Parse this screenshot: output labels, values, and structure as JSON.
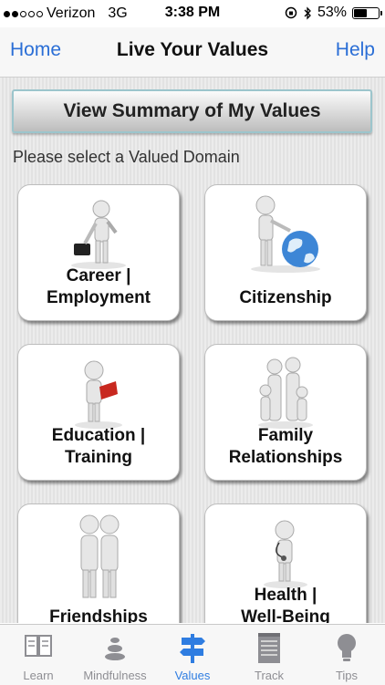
{
  "status": {
    "carrier": "Verizon",
    "network": "3G",
    "time": "3:38 PM",
    "battery_text": "53%",
    "battery_level": 0.53
  },
  "nav": {
    "left": "Home",
    "title": "Live Your Values",
    "right": "Help"
  },
  "summary_button": "View Summary of My Values",
  "prompt": "Please select a Valued Domain",
  "domains": [
    {
      "line1": "Career |",
      "line2": "Employment",
      "icon": "businessman-briefcase-icon"
    },
    {
      "line1": "Citizenship",
      "line2": "",
      "icon": "figure-with-globe-icon"
    },
    {
      "line1": "Education |",
      "line2": "Training",
      "icon": "figure-reading-book-icon"
    },
    {
      "line1": "Family",
      "line2": "Relationships",
      "icon": "family-group-icon"
    },
    {
      "line1": "Friendships",
      "line2": "",
      "icon": "two-friends-icon"
    },
    {
      "line1": "Health |",
      "line2": "Well-Being",
      "icon": "figure-with-stethoscope-icon"
    }
  ],
  "tabs": [
    {
      "label": "Learn",
      "icon": "book-icon",
      "active": false
    },
    {
      "label": "Mindfulness",
      "icon": "stones-icon",
      "active": false
    },
    {
      "label": "Values",
      "icon": "signpost-icon",
      "active": true
    },
    {
      "label": "Track",
      "icon": "notepad-icon",
      "active": false
    },
    {
      "label": "Tips",
      "icon": "lightbulb-icon",
      "active": false
    }
  ],
  "colors": {
    "link_blue": "#2a6ed6",
    "tab_active": "#2f7de1",
    "tab_inactive": "#8e8e93"
  }
}
